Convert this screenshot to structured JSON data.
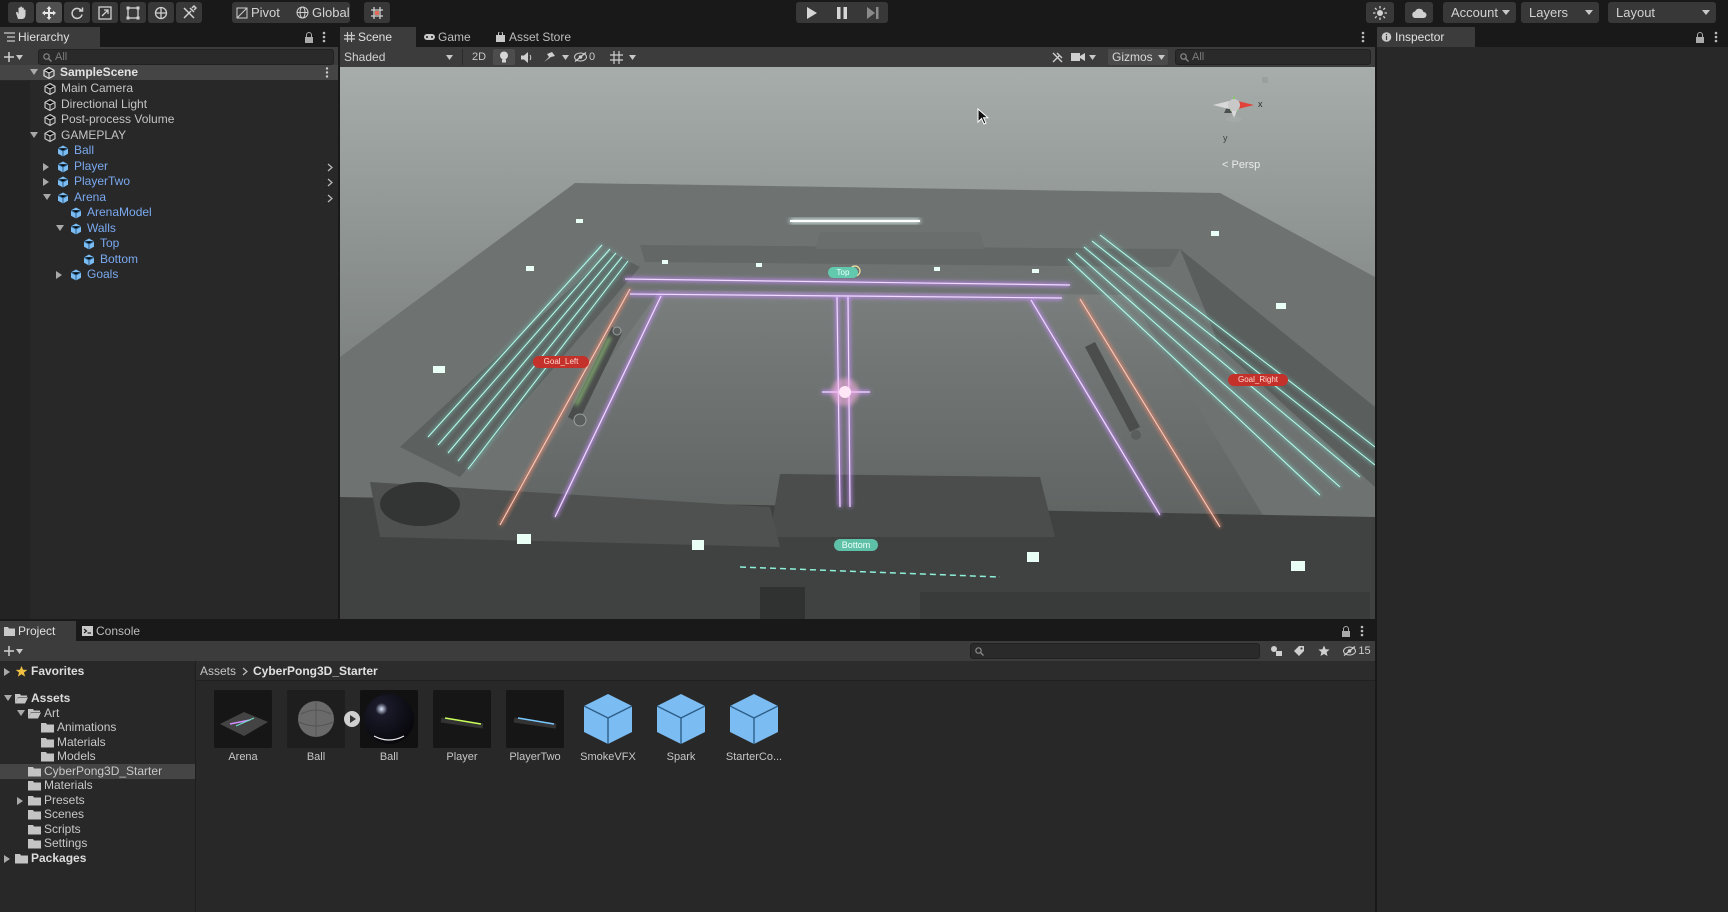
{
  "toolbar": {
    "tools": [
      "hand-tool",
      "move-tool",
      "rotate-tool",
      "scale-tool",
      "rect-tool",
      "transform-tool",
      "custom-tool"
    ],
    "pivot_label": "Pivot",
    "global_label": "Global",
    "account_label": "Account",
    "layers_label": "Layers",
    "layout_label": "Layout"
  },
  "hierarchy": {
    "tab_label": "Hierarchy",
    "search_placeholder": "All",
    "scene_name": "SampleScene",
    "items": [
      {
        "label": "Main Camera",
        "depth": 1,
        "fold": "none",
        "prefab": false,
        "arrow": false
      },
      {
        "label": "Directional Light",
        "depth": 1,
        "fold": "none",
        "prefab": false,
        "arrow": false
      },
      {
        "label": "Post-process Volume",
        "depth": 1,
        "fold": "none",
        "prefab": false,
        "arrow": false
      },
      {
        "label": "GAMEPLAY",
        "depth": 1,
        "fold": "open",
        "prefab": false,
        "arrow": false
      },
      {
        "label": "Ball",
        "depth": 2,
        "fold": "none",
        "prefab": true,
        "arrow": false
      },
      {
        "label": "Player",
        "depth": 2,
        "fold": "closed",
        "prefab": true,
        "arrow": true
      },
      {
        "label": "PlayerTwo",
        "depth": 2,
        "fold": "closed",
        "prefab": true,
        "arrow": true
      },
      {
        "label": "Arena",
        "depth": 2,
        "fold": "open",
        "prefab": true,
        "arrow": true
      },
      {
        "label": "ArenaModel",
        "depth": 3,
        "fold": "none",
        "prefab": true,
        "arrow": false
      },
      {
        "label": "Walls",
        "depth": 3,
        "fold": "open",
        "prefab": true,
        "arrow": false
      },
      {
        "label": "Top",
        "depth": 4,
        "fold": "none",
        "prefab": true,
        "arrow": false
      },
      {
        "label": "Bottom",
        "depth": 4,
        "fold": "none",
        "prefab": true,
        "arrow": false
      },
      {
        "label": "Goals",
        "depth": 3,
        "fold": "closed",
        "prefab": true,
        "arrow": false
      }
    ]
  },
  "scene_view": {
    "tabs": [
      {
        "label": "Scene",
        "selected": true
      },
      {
        "label": "Game",
        "selected": false
      },
      {
        "label": "Asset Store",
        "selected": false
      }
    ],
    "shading_mode": "Shaded",
    "mode_2d_label": "2D",
    "hidden_count": "0",
    "gizmos_label": "Gizmos",
    "search_placeholder": "All",
    "persp_label": "< Persp",
    "axis_labels": {
      "y": "y",
      "x": "x"
    },
    "scene_labels": {
      "top": "Top",
      "bottom": "Bottom",
      "goal_left": "Goal_Left",
      "goal_right": "Goal_Right"
    }
  },
  "inspector": {
    "tab_label": "Inspector"
  },
  "project": {
    "tabs": [
      {
        "label": "Project",
        "selected": true
      },
      {
        "label": "Console",
        "selected": false
      }
    ],
    "hidden_packages_count": "15",
    "breadcrumb": [
      "Assets",
      "CyberPong3D_Starter"
    ],
    "tree": [
      {
        "label": "Favorites",
        "depth": 0,
        "fold": "closed",
        "icon": "star",
        "bold": true
      },
      {
        "label": "Assets",
        "depth": 0,
        "fold": "open",
        "icon": "folder-open",
        "bold": true
      },
      {
        "label": "Art",
        "depth": 1,
        "fold": "open",
        "icon": "folder-open",
        "bold": false
      },
      {
        "label": "Animations",
        "depth": 2,
        "fold": "none",
        "icon": "folder",
        "bold": false
      },
      {
        "label": "Materials",
        "depth": 2,
        "fold": "none",
        "icon": "folder",
        "bold": false
      },
      {
        "label": "Models",
        "depth": 2,
        "fold": "none",
        "icon": "folder",
        "bold": false
      },
      {
        "label": "CyberPong3D_Starter",
        "depth": 1,
        "fold": "none",
        "icon": "folder",
        "bold": false,
        "selected": true
      },
      {
        "label": "Materials",
        "depth": 1,
        "fold": "none",
        "icon": "folder",
        "bold": false
      },
      {
        "label": "Presets",
        "depth": 1,
        "fold": "closed",
        "icon": "folder",
        "bold": false
      },
      {
        "label": "Scenes",
        "depth": 1,
        "fold": "none",
        "icon": "folder",
        "bold": false
      },
      {
        "label": "Scripts",
        "depth": 1,
        "fold": "none",
        "icon": "folder",
        "bold": false
      },
      {
        "label": "Settings",
        "depth": 1,
        "fold": "none",
        "icon": "folder",
        "bold": false
      },
      {
        "label": "Packages",
        "depth": 0,
        "fold": "closed",
        "icon": "folder",
        "bold": true
      }
    ],
    "assets": [
      {
        "label": "Arena",
        "kind": "arena-thumbnail"
      },
      {
        "label": "Ball",
        "kind": "model-thumbnail"
      },
      {
        "label": "Ball",
        "kind": "material-thumbnail"
      },
      {
        "label": "Player",
        "kind": "player-thumbnail"
      },
      {
        "label": "PlayerTwo",
        "kind": "playertwo-thumbnail"
      },
      {
        "label": "SmokeVFX",
        "kind": "prefab-icon"
      },
      {
        "label": "Spark",
        "kind": "prefab-icon"
      },
      {
        "label": "StarterCo...",
        "kind": "prefab-icon"
      }
    ]
  },
  "colors": {
    "accent_blue": "#7aa9f0",
    "selection": "#2c5d87",
    "prefab_cube": "#7bbcf2",
    "goal_red": "#c4312a",
    "wall_teal": "#5fc9b3"
  }
}
